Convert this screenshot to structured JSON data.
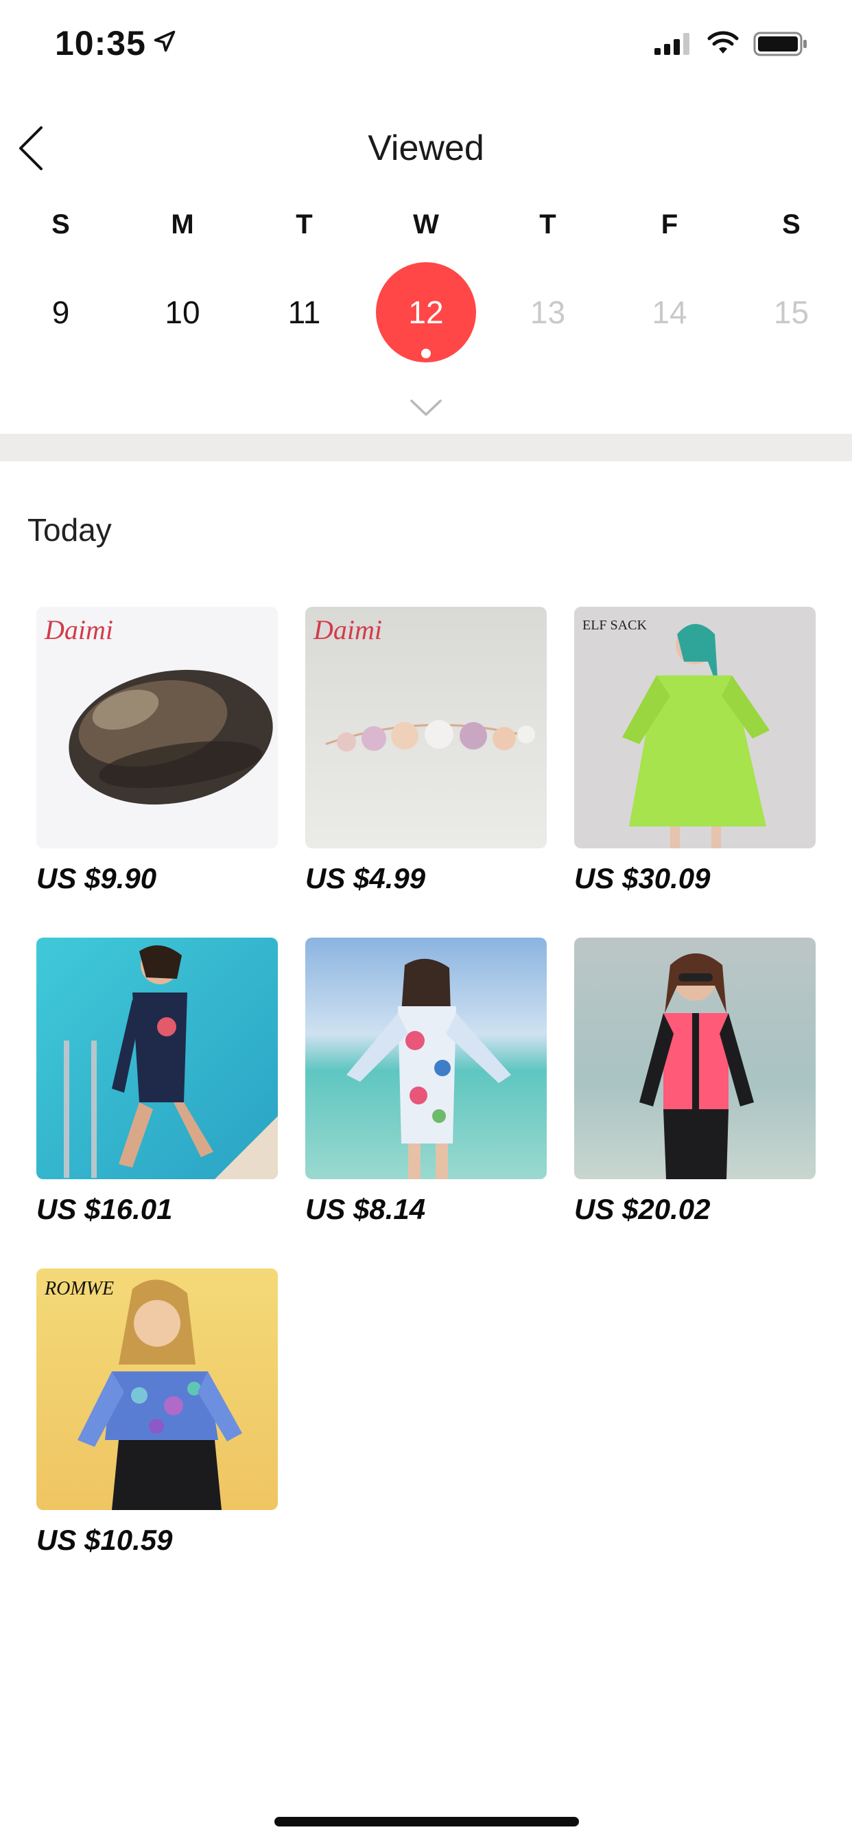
{
  "status_bar": {
    "time": "10:35"
  },
  "header": {
    "title": "Viewed"
  },
  "calendar": {
    "weekdays": [
      "S",
      "M",
      "T",
      "W",
      "T",
      "F",
      "S"
    ],
    "dates": [
      {
        "label": "9",
        "state": "past"
      },
      {
        "label": "10",
        "state": "past"
      },
      {
        "label": "11",
        "state": "past"
      },
      {
        "label": "12",
        "state": "selected"
      },
      {
        "label": "13",
        "state": "future"
      },
      {
        "label": "14",
        "state": "future"
      },
      {
        "label": "15",
        "state": "future"
      }
    ],
    "selected_color": "#ff4747"
  },
  "section": {
    "title": "Today"
  },
  "products": [
    {
      "price": "US $9.90",
      "brand": "Daimi",
      "image": "mussel-shell"
    },
    {
      "price": "US $4.99",
      "brand": "Daimi",
      "image": "pearl-bracelet"
    },
    {
      "price": "US $30.09",
      "brand": "ELF SACK",
      "image": "green-dress"
    },
    {
      "price": "US $16.01",
      "brand": "",
      "image": "navy-swimsuit"
    },
    {
      "price": "US $8.14",
      "brand": "",
      "image": "floral-swimsuit"
    },
    {
      "price": "US $20.02",
      "brand": "",
      "image": "pink-rash-guard"
    },
    {
      "price": "US $10.59",
      "brand": "ROMWE",
      "image": "sequin-top"
    }
  ]
}
